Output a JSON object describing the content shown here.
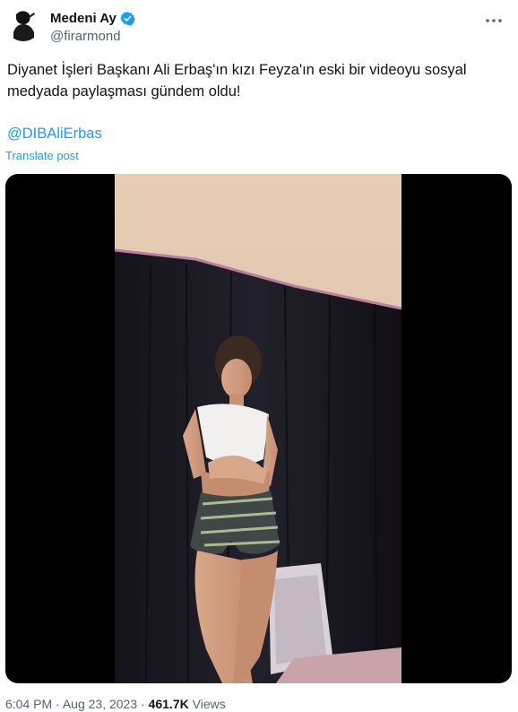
{
  "author": {
    "display_name": "Medeni Ay",
    "handle": "@firarmond",
    "verified": true
  },
  "tweet": {
    "text": "Diyanet İşleri Başkanı Ali Erbaş'ın kızı Feyza'ın eski bir videoyu sosyal medyada paylaşması gündem oldu!",
    "mention": "@DIBAliErbas",
    "translate_label": "Translate post"
  },
  "meta": {
    "time": "6:04 PM",
    "date": "Aug 23, 2023",
    "separator": "·",
    "views_count": "461.7K",
    "views_label": "Views"
  },
  "icons": {
    "more": "more-icon",
    "verified": "verified-badge-icon"
  },
  "colors": {
    "link": "#1d9bf0",
    "secondary_text": "#536471",
    "primary_text": "#0f1419",
    "verified_badge": "#1d9bf0"
  }
}
